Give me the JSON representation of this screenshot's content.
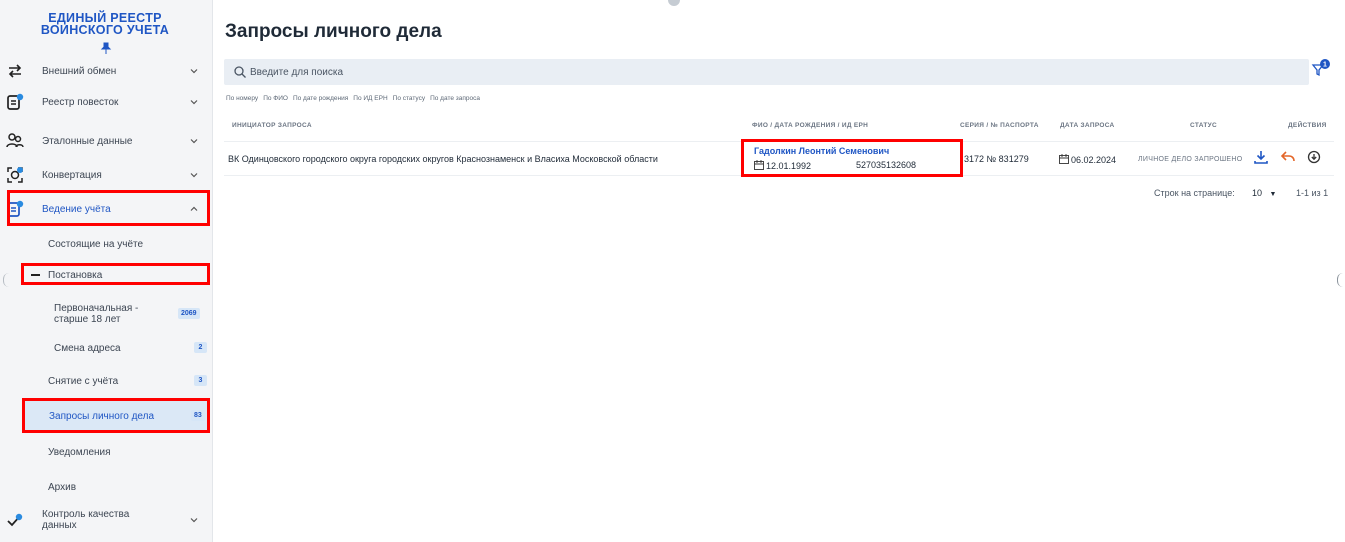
{
  "sidebar": {
    "logo_line1": "ЕДИНЫЙ РЕЕСТР",
    "logo_line2": "ВОИНСКОГО УЧЕТА",
    "items": [
      {
        "label": "Внешний обмен",
        "icon": "exchange-arrows-icon"
      },
      {
        "label": "Реестр повесток",
        "icon": "document-notification-icon"
      },
      {
        "label": "Эталонные данные",
        "icon": "users-group-icon"
      },
      {
        "label": "Конвертация",
        "icon": "convert-scan-icon"
      },
      {
        "label": "Ведение учёта",
        "icon": "registry-document-icon"
      },
      {
        "label": "Контроль качества данных",
        "icon": "quality-check-icon"
      }
    ],
    "subitems": {
      "registered": {
        "label": "Состоящие на учёте"
      },
      "enrollment": {
        "label": "Постановка"
      },
      "initial": {
        "label": "Первоначальная - старше 18 лет",
        "badge": "2069"
      },
      "address_change": {
        "label": "Смена адреса",
        "badge": "2"
      },
      "deregistration": {
        "label": "Снятие с учёта",
        "badge": "3"
      },
      "requests": {
        "label": "Запросы личного дела",
        "badge": "83"
      },
      "notifications": {
        "label": "Уведомления"
      },
      "archive": {
        "label": "Архив"
      }
    }
  },
  "main": {
    "title": "Запросы личного дела",
    "search_placeholder": "Введите для поиска",
    "filter_badge": "1",
    "filter_chips": [
      "По номеру",
      "По ФИО",
      "По дате рождения",
      "По ИД ЕРН",
      "По статусу",
      "По дате запроса"
    ],
    "columns": {
      "initiator": "ИНИЦИАТОР ЗАПРОСА",
      "person": "ФИО / ДАТА РОЖДЕНИЯ / ИД ЕРН",
      "passport": "СЕРИЯ / № ПАСПОРТА",
      "request_date": "ДАТА ЗАПРОСА",
      "status": "СТАТУС",
      "actions": "ДЕЙСТВИЯ"
    },
    "rows": [
      {
        "initiator": "ВК Одинцовского городского округа городских округов Краснознаменск и Власиха Московской области",
        "name": "Гадолкин Леонтий Семенович",
        "birth_date": "12.01.1992",
        "ern_id": "527035132608",
        "passport": "3172 № 831279",
        "request_date": "06.02.2024",
        "status": "ЛИЧНОЕ ДЕЛО ЗАПРОШЕНО"
      }
    ],
    "pager": {
      "rows_label": "Строк на странице:",
      "rows_value": "10",
      "range": "1-1 из 1"
    }
  },
  "colors": {
    "accent": "#1f56c4",
    "highlight": "#ff0000",
    "selected_bg": "#dbe8f6",
    "status_dot": "#2a8be0"
  }
}
